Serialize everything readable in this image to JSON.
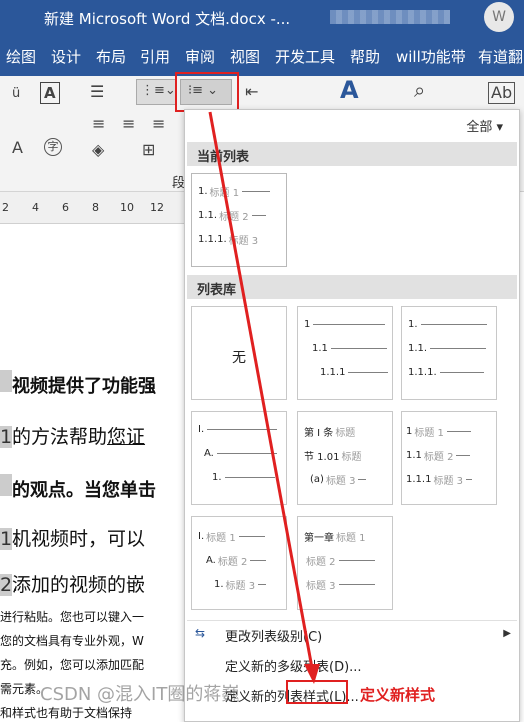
{
  "titlebar": {
    "title": "新建 Microsoft Word 文档.docx  -...",
    "avatar_letter": "W"
  },
  "ribbon_tabs": [
    "绘图",
    "设计",
    "布局",
    "引用",
    "审阅",
    "视图",
    "开发工具",
    "帮助",
    "will功能带",
    "有道翻"
  ],
  "ribbon": {
    "paragraph_group_label": "段"
  },
  "ruler": [
    "2",
    "4",
    "6",
    "8",
    "10",
    "12"
  ],
  "document": {
    "line1": "视频提供了功能强",
    "line2_num": "1.",
    "line2_a": "的方法帮助",
    "line2_u": "您证",
    "line3": "的观点。当您单击",
    "line4_num": "1.",
    "line4": "机视频时，可以",
    "line5_num": "2.",
    "line5": "添加的视频的嵌",
    "line6": "进行粘贴。您也可以键入一",
    "line7": "您的文档具有专业外观，W",
    "line8": "充。例如，您可以添加匹配",
    "line9": "需元素。",
    "line10": "和样式也有助于文档保持"
  },
  "panel": {
    "filter_label": "全部",
    "current_header": "当前列表",
    "library_header": "列表库",
    "current_list": [
      {
        "num": "1.",
        "label": "标题 1"
      },
      {
        "num": "1.1.",
        "label": "标题 2"
      },
      {
        "num": "1.1.1.",
        "label": "标题 3"
      }
    ],
    "library": {
      "none_label": "无",
      "numeric": [
        {
          "num": "1"
        },
        {
          "num": "1.1"
        },
        {
          "num": "1.1.1"
        }
      ],
      "numeric_dot": [
        {
          "num": "1."
        },
        {
          "num": "1.1."
        },
        {
          "num": "1.1.1."
        }
      ],
      "roman": [
        {
          "num": "I."
        },
        {
          "num": "A."
        },
        {
          "num": "1."
        }
      ],
      "article": [
        {
          "num": "第 I 条",
          "label": "标题"
        },
        {
          "num": "节 1.01",
          "label": "标题"
        },
        {
          "num": "(a)",
          "label": "标题 3"
        }
      ],
      "heading_numeric": [
        {
          "num": "1",
          "label": "标题 1"
        },
        {
          "num": "1.1",
          "label": "标题 2"
        },
        {
          "num": "1.1.1",
          "label": "标题 3"
        }
      ],
      "heading_roman": [
        {
          "num": "I.",
          "label": "标题 1"
        },
        {
          "num": "A.",
          "label": "标题 2"
        },
        {
          "num": "1.",
          "label": "标题 3"
        }
      ],
      "chapter": [
        {
          "num": "第一章",
          "label": "标题 1"
        },
        {
          "num": "",
          "label": "标题 2"
        },
        {
          "num": "",
          "label": "标题 3"
        }
      ]
    },
    "menu": {
      "change_level": "更改列表级别(C)",
      "define_new_list": "定义新的多级列表(D)...",
      "define_new_style": "定义新的列表样式(L)..."
    }
  },
  "annotation": {
    "text": "定义新样式",
    "color": "#e02020"
  },
  "watermark": "CSDN @混入IT圈的蒋巍 "
}
